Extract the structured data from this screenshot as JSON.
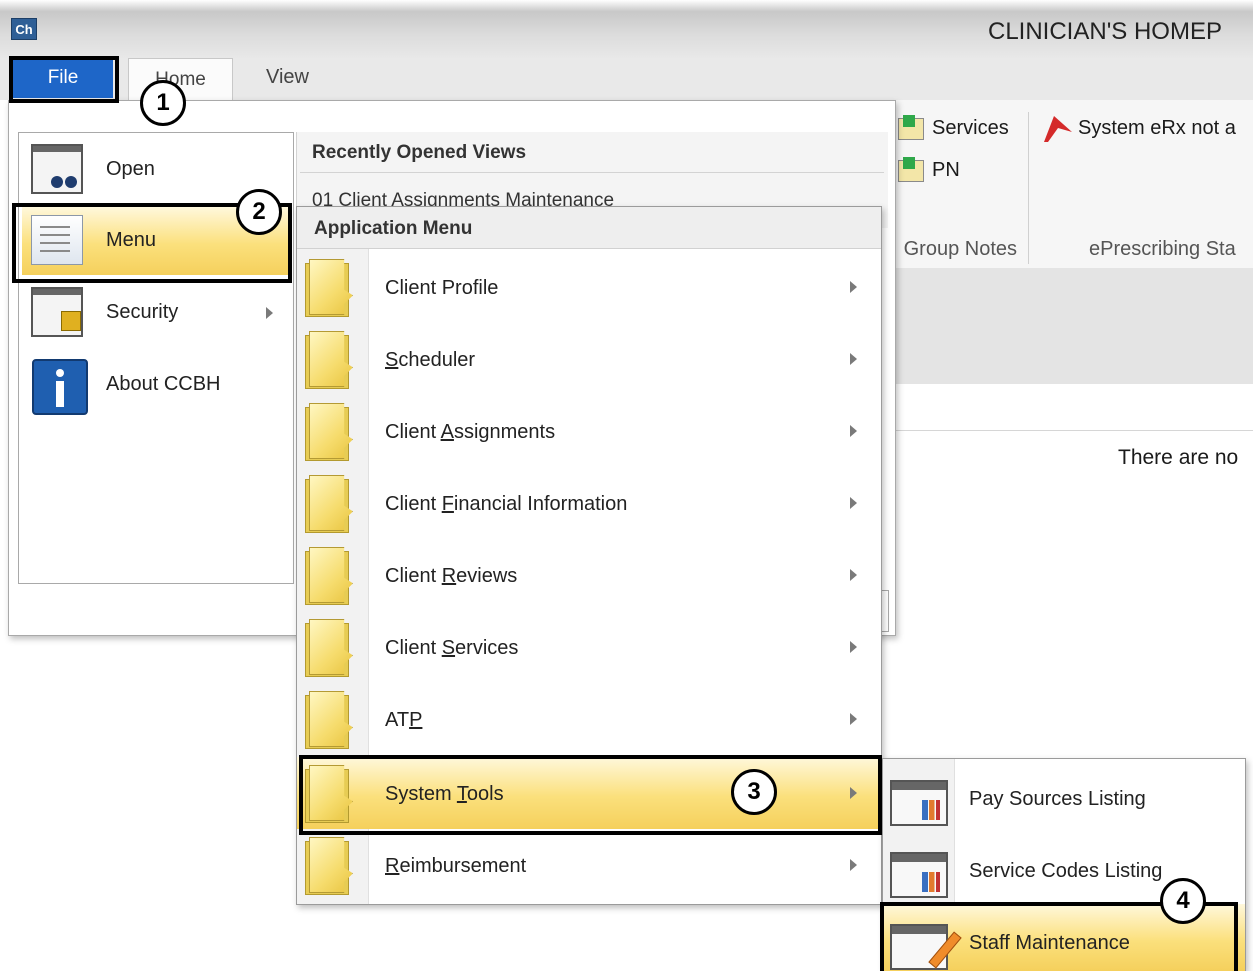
{
  "window": {
    "title": "CLINICIAN'S HOMEP",
    "logo_text": "Ch"
  },
  "ribbon_tabs": {
    "file": "File",
    "home": "Home",
    "view": "View"
  },
  "ribbon": {
    "services": "Services",
    "pn": "PN",
    "group_notes": "Group Notes",
    "erx_status": "System eRx not a",
    "eprescribing": "ePrescribing Sta"
  },
  "main": {
    "no_items_text": "There are no"
  },
  "file_menu": {
    "items": [
      {
        "label": "Open",
        "icon": "binoculars-icon"
      },
      {
        "label": "Menu",
        "icon": "menu-document-icon"
      },
      {
        "label": "Security",
        "icon": "security-lock-icon"
      },
      {
        "label": "About CCBH",
        "icon": "info-icon"
      }
    ],
    "recent_title": "Recently Opened Views",
    "recent_items": [
      "01 Client Assignments Maintenance"
    ]
  },
  "app_menu": {
    "title": "Application Menu",
    "items": [
      {
        "pre": "Client Profile",
        "key": "",
        "post": ""
      },
      {
        "pre": "",
        "key": "S",
        "post": "cheduler"
      },
      {
        "pre": "Client ",
        "key": "A",
        "post": "ssignments"
      },
      {
        "pre": "Client ",
        "key": "F",
        "post": "inancial Information"
      },
      {
        "pre": "Client ",
        "key": "R",
        "post": "eviews"
      },
      {
        "pre": "Client ",
        "key": "S",
        "post": "ervices"
      },
      {
        "pre": "AT",
        "key": "P",
        "post": ""
      },
      {
        "pre": "System ",
        "key": "T",
        "post": "ools"
      },
      {
        "pre": "",
        "key": "R",
        "post": "eimbursement"
      }
    ]
  },
  "system_tools_menu": {
    "items": [
      {
        "label": "Pay Sources Listing"
      },
      {
        "label": "Service Codes Listing"
      },
      {
        "label": "Staff Maintenance"
      }
    ]
  },
  "callouts": [
    "1",
    "2",
    "3",
    "4"
  ],
  "colors": {
    "file_tab": "#1e66c8",
    "highlight": "#fbe07c",
    "erx_flag": "#d42a2a"
  }
}
